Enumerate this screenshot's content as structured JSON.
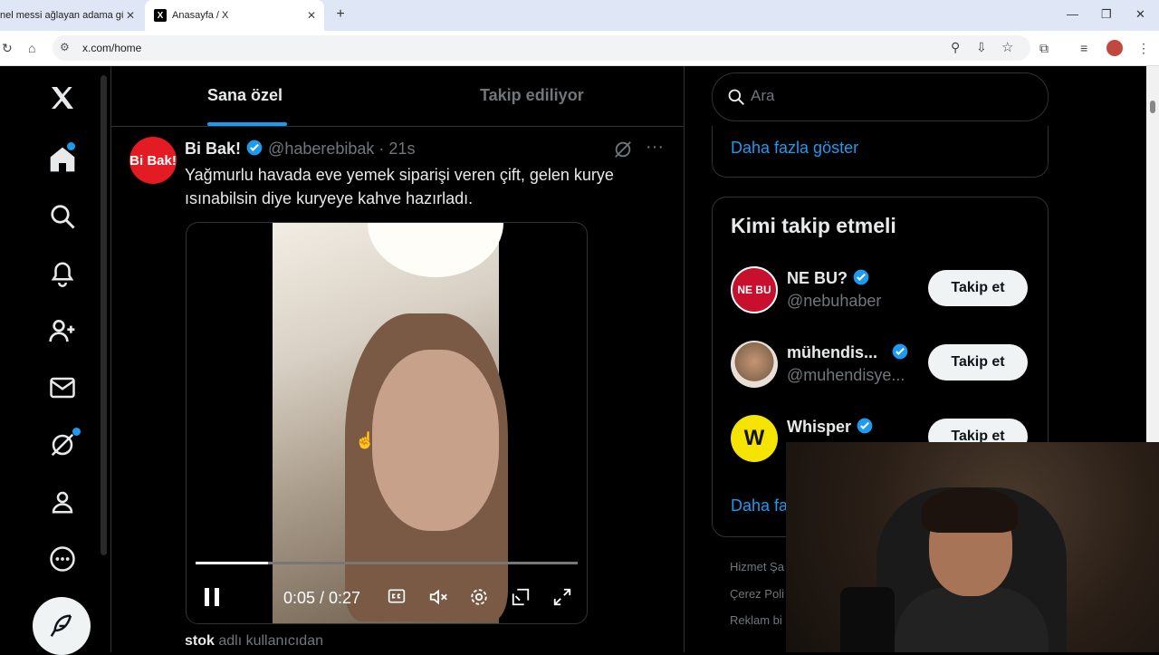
{
  "browser": {
    "tabs": [
      {
        "title": "nel messi ağlayan adama gül",
        "active": false
      },
      {
        "title": "Anasayfa / X",
        "active": true
      }
    ],
    "url": "x.com/home"
  },
  "feed": {
    "tabs": [
      "Sana özel",
      "Takip ediliyor"
    ],
    "tweet": {
      "avatar_text": "Bi Bak!",
      "author": "Bi Bak!",
      "handle": "@haberebibak",
      "time": "· 21s",
      "text": "Yağmurlu havada eve yemek siparişi veren çift, gelen kurye ısınabilsin diye kuryeye kahve hazırladı.",
      "video": {
        "time": "0:05 / 0:27",
        "progress": 0.19
      }
    },
    "retweet_note_user": "stok",
    "retweet_note_text": " adlı kullanıcıdan"
  },
  "sidebar_right": {
    "search_placeholder": "Ara",
    "show_more": "Daha fazla göster",
    "who_to_follow_title": "Kimi takip etmeli",
    "suggestions": [
      {
        "name": "NE BU?",
        "handle": "@nebuhaber",
        "avatar": "NE BU",
        "avatar_color": "#c8102e",
        "button": "Takip et"
      },
      {
        "name": "mühendis...",
        "handle": "@muhendisye...",
        "avatar": "",
        "avatar_color": "#b89a78",
        "button": "Takip et"
      },
      {
        "name": "Whisper",
        "handle": "",
        "avatar": "W",
        "avatar_color": "#f5e400",
        "button": "Takip et"
      }
    ],
    "show_more_2": "Daha fa",
    "footer": [
      "Hizmet Şa",
      "Çerez Poli",
      "Reklam bi"
    ]
  },
  "colors": {
    "accent": "#1d9bf0",
    "background": "#000000"
  }
}
